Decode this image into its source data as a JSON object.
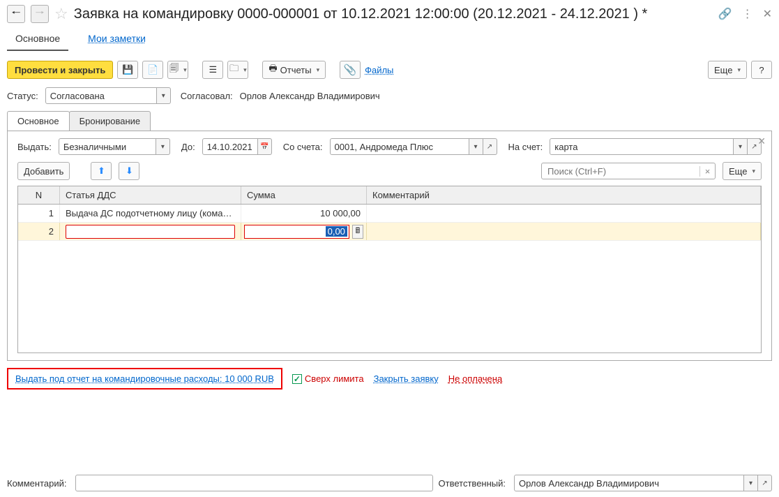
{
  "title": "Заявка на командировку 0000-000001 от 10.12.2021 12:00:00 (20.12.2021 - 24.12.2021 ) *",
  "main_tabs": {
    "main": "Основное",
    "notes": "Мои заметки"
  },
  "toolbar": {
    "post_close": "Провести и закрыть",
    "reports": "Отчеты",
    "files": "Файлы",
    "more": "Еще"
  },
  "status": {
    "label": "Статус:",
    "value": "Согласована",
    "approver_label": "Согласовал:",
    "approver": "Орлов Александр Владимирович"
  },
  "sub_tabs": {
    "main": "Основное",
    "booking": "Бронирование"
  },
  "issue": {
    "label": "Выдать:",
    "method": "Безналичными",
    "until_label": "До:",
    "until": "14.10.2021",
    "from_acc_label": "Со счета:",
    "from_acc": "0001, Андромеда Плюс",
    "to_acc_label": "На счет:",
    "to_acc": "карта"
  },
  "inner_tb": {
    "add": "Добавить",
    "search_ph": "Поиск (Ctrl+F)",
    "more": "Еще"
  },
  "grid": {
    "headers": {
      "n": "N",
      "article": "Статья ДДС",
      "sum": "Сумма",
      "comment": "Комментарий"
    },
    "rows": [
      {
        "n": "1",
        "article": "Выдача ДС подотчетному лицу (кома…",
        "sum": "10 000,00",
        "comment": ""
      },
      {
        "n": "2",
        "article": "",
        "sum": "0,00",
        "comment": ""
      }
    ]
  },
  "links": {
    "issue_report": "Выдать под отчет на командировочные расходы: 10 000 RUB",
    "over_limit": "Сверх лимита",
    "close_req": "Закрыть заявку",
    "not_paid": "Не оплачена"
  },
  "footer": {
    "comment_label": "Комментарий:",
    "resp_label": "Ответственный:",
    "resp": "Орлов Александр Владимирович"
  },
  "help": "?"
}
